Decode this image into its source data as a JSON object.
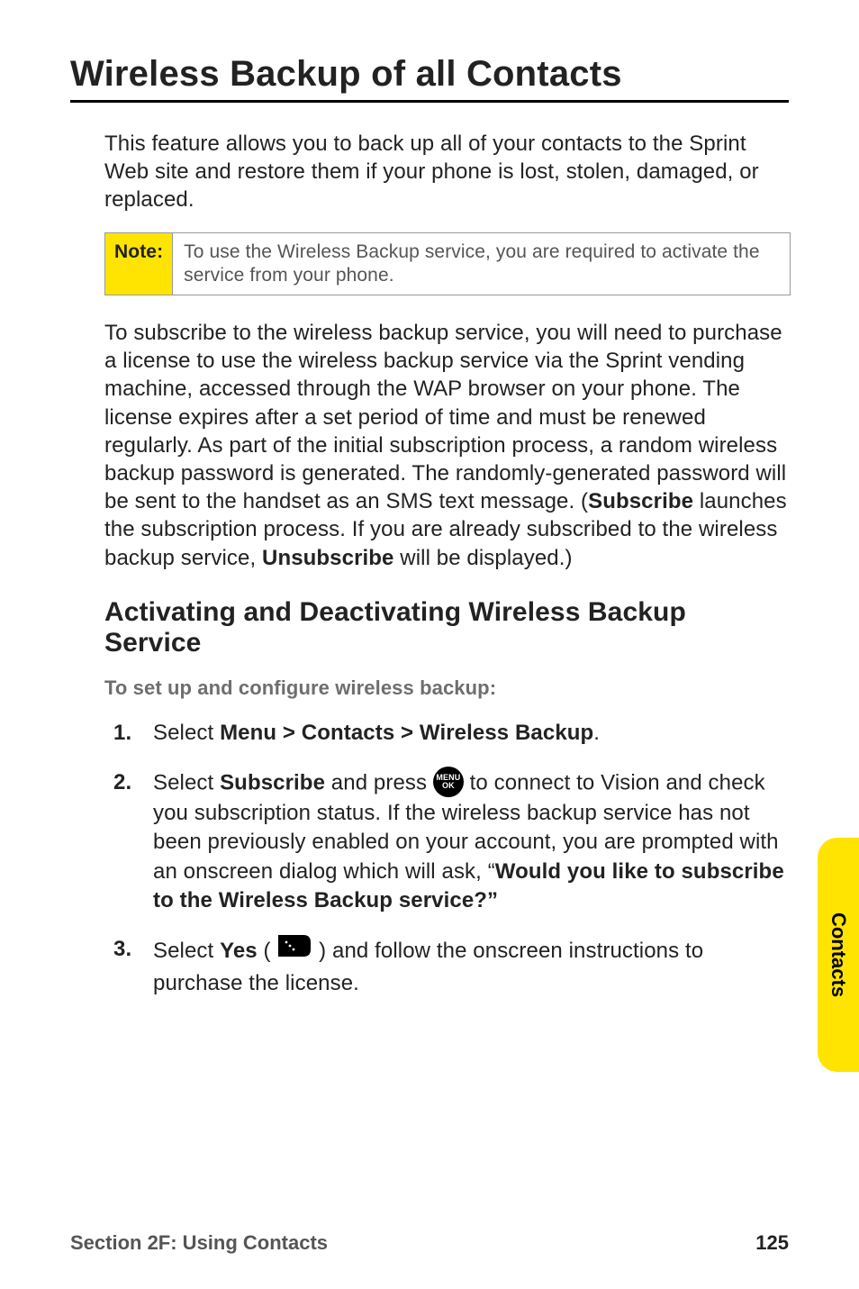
{
  "title": "Wireless Backup of all Contacts",
  "intro": "This feature allows you to back up all of your contacts to the Sprint Web site and restore them if your phone is lost, stolen, damaged, or replaced.",
  "note": {
    "label": "Note:",
    "text": "To use the Wireless Backup service, you are required to activate the service from your phone."
  },
  "para2_a": "To subscribe to the wireless backup service, you will need to purchase a license to use the wireless backup service via the Sprint vending machine, accessed through the WAP browser on your phone. The license expires after a set period of time and must be renewed regularly. As part of the initial subscription process, a random wireless backup password is generated. The randomly-generated password will be sent to the handset as an SMS text message. (",
  "para2_sub": "Subscribe",
  "para2_b": " launches the subscription process. If you are already subscribed to the wireless backup service, ",
  "para2_unsub": "Unsubscribe",
  "para2_c": " will be displayed.)",
  "subhead": "Activating and Deactivating Wireless Backup Service",
  "configure_label": "To set up and configure wireless backup:",
  "steps": {
    "s1": {
      "num": "1.",
      "a": "Select ",
      "b": "Menu > Contacts > Wireless Backup",
      "c": "."
    },
    "s2": {
      "num": "2.",
      "a": "Select ",
      "b": "Subscribe",
      "c": " and press ",
      "d": " to connect to Vision and check you subscription status. If the wireless backup service has not been previously enabled on your account, you are prompted with an onscreen dialog which will ask, “",
      "e": "Would you like to subscribe to the Wireless Backup service?”"
    },
    "s3": {
      "num": "3.",
      "a": "Select ",
      "b": "Yes",
      "c": " ( ",
      "d": " ) and follow the onscreen instructions to purchase the license."
    }
  },
  "menu_key": {
    "top": "MENU",
    "bottom": "OK"
  },
  "side_tab": "Contacts",
  "footer": {
    "section": "Section 2F: Using Contacts",
    "page": "125"
  }
}
